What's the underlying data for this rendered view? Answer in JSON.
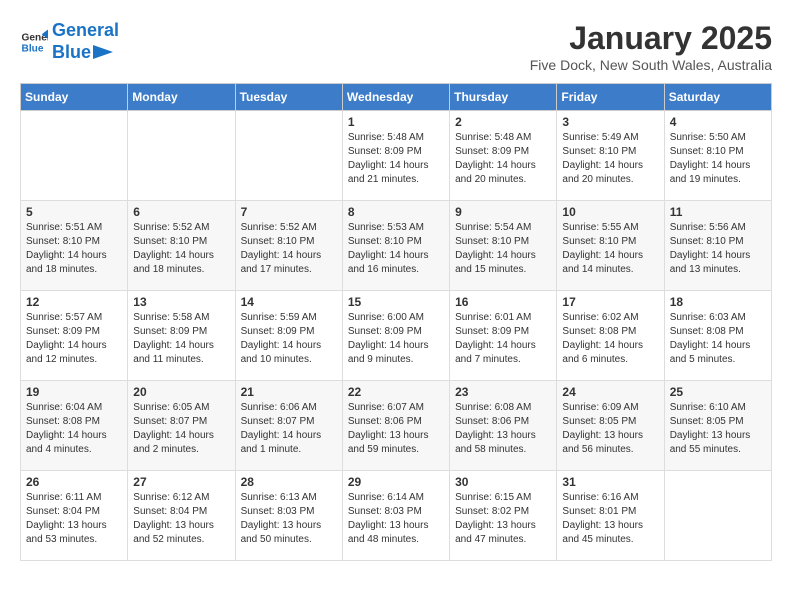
{
  "logo": {
    "line1": "General",
    "line2": "Blue"
  },
  "title": "January 2025",
  "location": "Five Dock, New South Wales, Australia",
  "weekdays": [
    "Sunday",
    "Monday",
    "Tuesday",
    "Wednesday",
    "Thursday",
    "Friday",
    "Saturday"
  ],
  "weeks": [
    [
      {
        "day": "",
        "detail": ""
      },
      {
        "day": "",
        "detail": ""
      },
      {
        "day": "",
        "detail": ""
      },
      {
        "day": "1",
        "detail": "Sunrise: 5:48 AM\nSunset: 8:09 PM\nDaylight: 14 hours\nand 21 minutes."
      },
      {
        "day": "2",
        "detail": "Sunrise: 5:48 AM\nSunset: 8:09 PM\nDaylight: 14 hours\nand 20 minutes."
      },
      {
        "day": "3",
        "detail": "Sunrise: 5:49 AM\nSunset: 8:10 PM\nDaylight: 14 hours\nand 20 minutes."
      },
      {
        "day": "4",
        "detail": "Sunrise: 5:50 AM\nSunset: 8:10 PM\nDaylight: 14 hours\nand 19 minutes."
      }
    ],
    [
      {
        "day": "5",
        "detail": "Sunrise: 5:51 AM\nSunset: 8:10 PM\nDaylight: 14 hours\nand 18 minutes."
      },
      {
        "day": "6",
        "detail": "Sunrise: 5:52 AM\nSunset: 8:10 PM\nDaylight: 14 hours\nand 18 minutes."
      },
      {
        "day": "7",
        "detail": "Sunrise: 5:52 AM\nSunset: 8:10 PM\nDaylight: 14 hours\nand 17 minutes."
      },
      {
        "day": "8",
        "detail": "Sunrise: 5:53 AM\nSunset: 8:10 PM\nDaylight: 14 hours\nand 16 minutes."
      },
      {
        "day": "9",
        "detail": "Sunrise: 5:54 AM\nSunset: 8:10 PM\nDaylight: 14 hours\nand 15 minutes."
      },
      {
        "day": "10",
        "detail": "Sunrise: 5:55 AM\nSunset: 8:10 PM\nDaylight: 14 hours\nand 14 minutes."
      },
      {
        "day": "11",
        "detail": "Sunrise: 5:56 AM\nSunset: 8:10 PM\nDaylight: 14 hours\nand 13 minutes."
      }
    ],
    [
      {
        "day": "12",
        "detail": "Sunrise: 5:57 AM\nSunset: 8:09 PM\nDaylight: 14 hours\nand 12 minutes."
      },
      {
        "day": "13",
        "detail": "Sunrise: 5:58 AM\nSunset: 8:09 PM\nDaylight: 14 hours\nand 11 minutes."
      },
      {
        "day": "14",
        "detail": "Sunrise: 5:59 AM\nSunset: 8:09 PM\nDaylight: 14 hours\nand 10 minutes."
      },
      {
        "day": "15",
        "detail": "Sunrise: 6:00 AM\nSunset: 8:09 PM\nDaylight: 14 hours\nand 9 minutes."
      },
      {
        "day": "16",
        "detail": "Sunrise: 6:01 AM\nSunset: 8:09 PM\nDaylight: 14 hours\nand 7 minutes."
      },
      {
        "day": "17",
        "detail": "Sunrise: 6:02 AM\nSunset: 8:08 PM\nDaylight: 14 hours\nand 6 minutes."
      },
      {
        "day": "18",
        "detail": "Sunrise: 6:03 AM\nSunset: 8:08 PM\nDaylight: 14 hours\nand 5 minutes."
      }
    ],
    [
      {
        "day": "19",
        "detail": "Sunrise: 6:04 AM\nSunset: 8:08 PM\nDaylight: 14 hours\nand 4 minutes."
      },
      {
        "day": "20",
        "detail": "Sunrise: 6:05 AM\nSunset: 8:07 PM\nDaylight: 14 hours\nand 2 minutes."
      },
      {
        "day": "21",
        "detail": "Sunrise: 6:06 AM\nSunset: 8:07 PM\nDaylight: 14 hours\nand 1 minute."
      },
      {
        "day": "22",
        "detail": "Sunrise: 6:07 AM\nSunset: 8:06 PM\nDaylight: 13 hours\nand 59 minutes."
      },
      {
        "day": "23",
        "detail": "Sunrise: 6:08 AM\nSunset: 8:06 PM\nDaylight: 13 hours\nand 58 minutes."
      },
      {
        "day": "24",
        "detail": "Sunrise: 6:09 AM\nSunset: 8:05 PM\nDaylight: 13 hours\nand 56 minutes."
      },
      {
        "day": "25",
        "detail": "Sunrise: 6:10 AM\nSunset: 8:05 PM\nDaylight: 13 hours\nand 55 minutes."
      }
    ],
    [
      {
        "day": "26",
        "detail": "Sunrise: 6:11 AM\nSunset: 8:04 PM\nDaylight: 13 hours\nand 53 minutes."
      },
      {
        "day": "27",
        "detail": "Sunrise: 6:12 AM\nSunset: 8:04 PM\nDaylight: 13 hours\nand 52 minutes."
      },
      {
        "day": "28",
        "detail": "Sunrise: 6:13 AM\nSunset: 8:03 PM\nDaylight: 13 hours\nand 50 minutes."
      },
      {
        "day": "29",
        "detail": "Sunrise: 6:14 AM\nSunset: 8:03 PM\nDaylight: 13 hours\nand 48 minutes."
      },
      {
        "day": "30",
        "detail": "Sunrise: 6:15 AM\nSunset: 8:02 PM\nDaylight: 13 hours\nand 47 minutes."
      },
      {
        "day": "31",
        "detail": "Sunrise: 6:16 AM\nSunset: 8:01 PM\nDaylight: 13 hours\nand 45 minutes."
      },
      {
        "day": "",
        "detail": ""
      }
    ]
  ]
}
